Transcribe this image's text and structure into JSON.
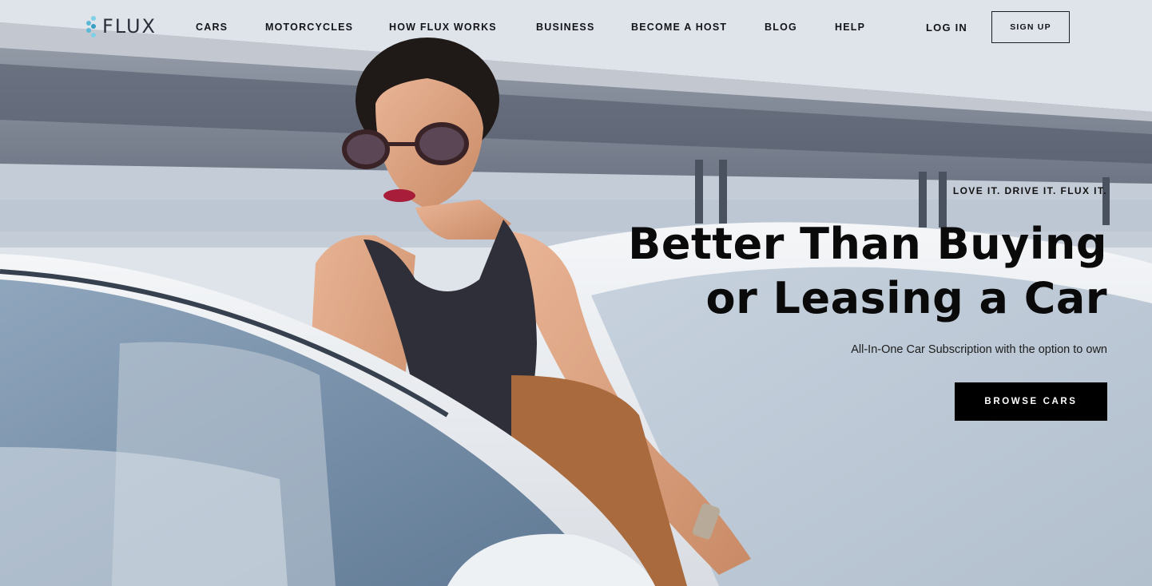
{
  "brand": {
    "name": "FLUX",
    "logo_icon": "flux-dots-icon",
    "accent_color": "#5bb8d6"
  },
  "nav": {
    "items": [
      {
        "label": "CARS"
      },
      {
        "label": "MOTORCYCLES"
      },
      {
        "label": "HOW FLUX WORKS"
      },
      {
        "label": "BUSINESS"
      },
      {
        "label": "BECOME A HOST"
      },
      {
        "label": "BLOG"
      },
      {
        "label": "HELP"
      }
    ],
    "login_label": "LOG IN",
    "signup_label": "SIGN UP"
  },
  "hero": {
    "tagline": "LOVE IT. DRIVE IT. FLUX IT.",
    "headline_line1": "Better Than Buying",
    "headline_line2": "or Leasing a Car",
    "subheadline": "All-In-One Car Subscription with the option to own",
    "cta_label": "BROWSE CARS",
    "cta_color": "#000000"
  }
}
